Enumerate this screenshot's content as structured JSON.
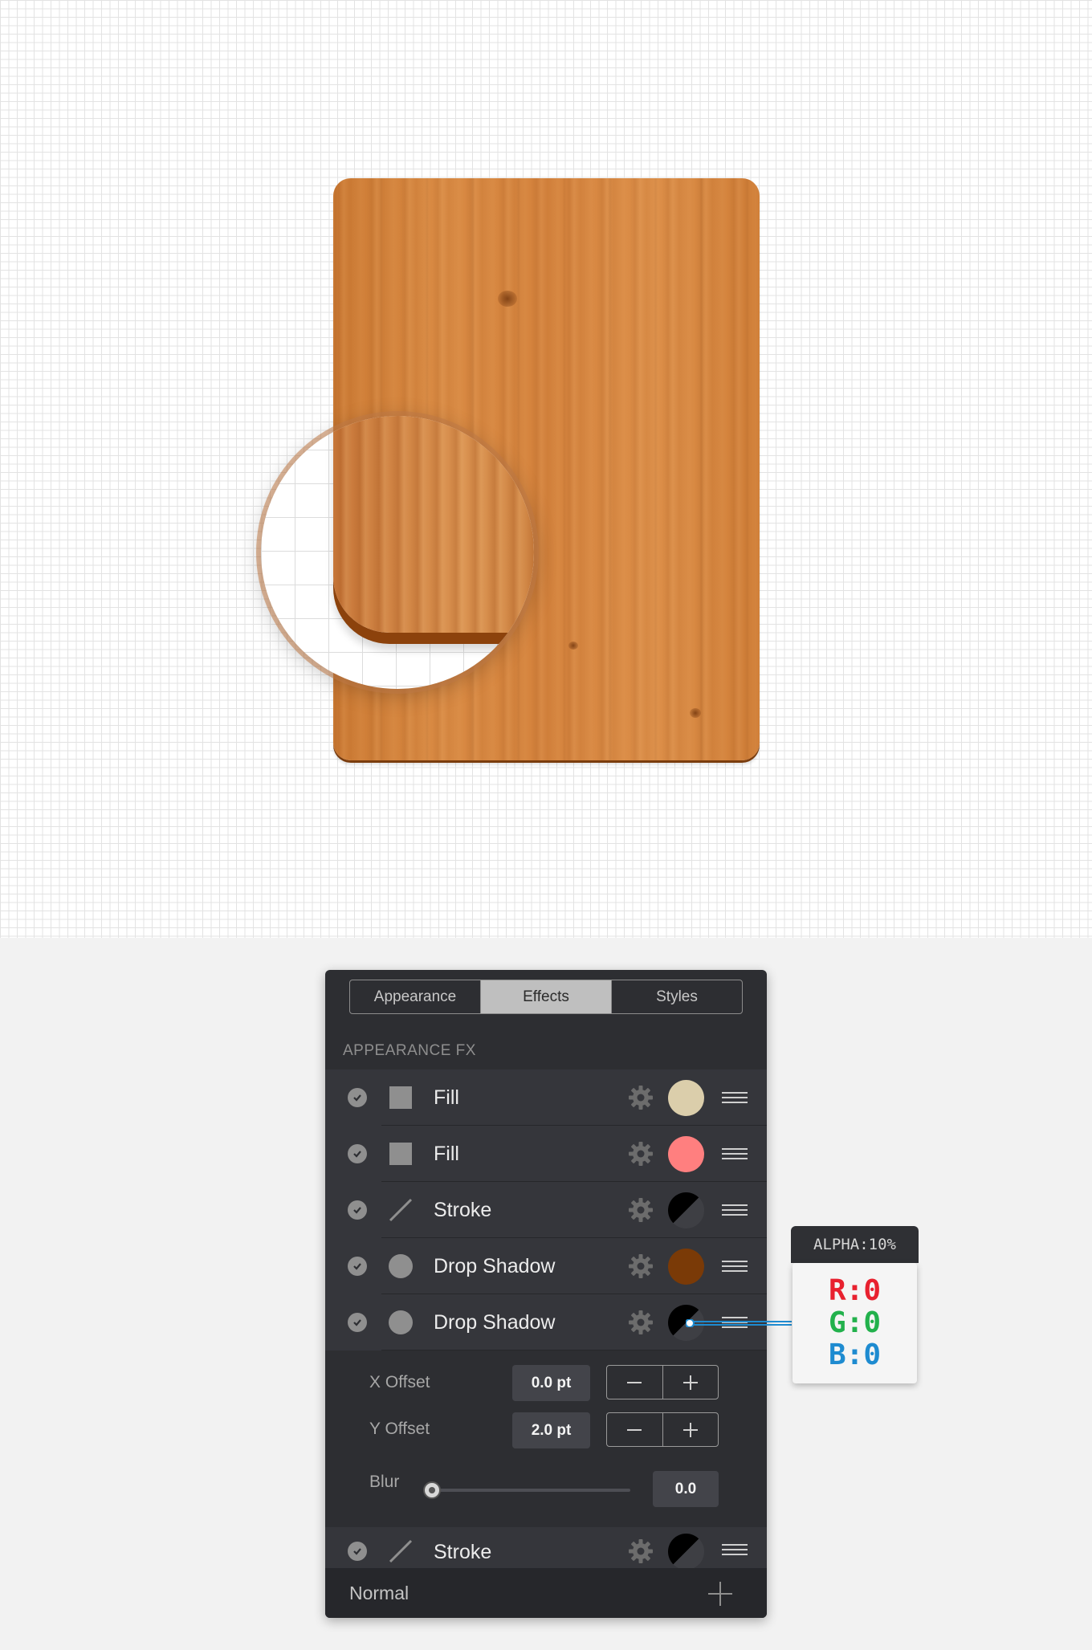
{
  "tabs": [
    {
      "label": "Appearance",
      "active": false
    },
    {
      "label": "Effects",
      "active": true
    },
    {
      "label": "Styles",
      "active": false
    }
  ],
  "section_title": "APPEARANCE FX",
  "fx_rows": [
    {
      "label": "Fill",
      "type_icon": "square-icon",
      "color": "#dbceab",
      "enabled": true
    },
    {
      "label": "Fill",
      "type_icon": "square-icon",
      "color": "#ff7f7f",
      "enabled": true
    },
    {
      "label": "Stroke",
      "type_icon": "line-icon",
      "color": "#000000",
      "enabled": true
    },
    {
      "label": "Drop Shadow",
      "type_icon": "circle-icon",
      "color": "#7a3a07",
      "enabled": true
    },
    {
      "label": "Drop Shadow",
      "type_icon": "circle-icon",
      "color": "#000000",
      "enabled": true
    }
  ],
  "detail": {
    "x_offset": {
      "label": "X Offset",
      "value": "0.0 pt"
    },
    "y_offset": {
      "label": "Y Offset",
      "value": "2.0 pt"
    },
    "blur": {
      "label": "Blur",
      "value": "0.0",
      "level": 0
    }
  },
  "last_row": {
    "label": "Stroke",
    "type_icon": "line-icon",
    "color": "#000000"
  },
  "footer": {
    "blend_mode": "Normal"
  },
  "tooltip": {
    "alpha": "ALPHA:10%",
    "r": "R:0",
    "g": "G:0",
    "b": "B:0"
  }
}
